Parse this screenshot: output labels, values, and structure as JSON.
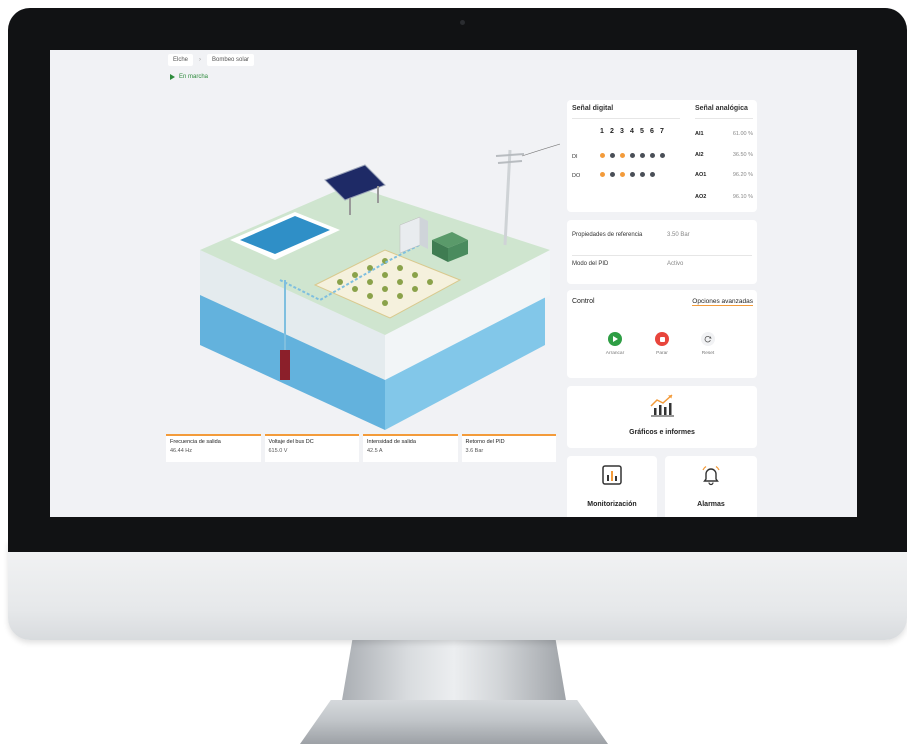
{
  "breadcrumb": {
    "location": "Elche",
    "separator": "›",
    "page": "Bombeo solar"
  },
  "status": {
    "label": "En marcha",
    "color": "#2e8b3c"
  },
  "metrics": [
    {
      "label": "Frecuencia de salida",
      "value": "46.44 Hz"
    },
    {
      "label": "Voltaje del bus DC",
      "value": "615.0 V"
    },
    {
      "label": "Intensidad de salida",
      "value": "42.5 A"
    },
    {
      "label": "Retorno del PID",
      "value": "3.6 Bar"
    }
  ],
  "signals": {
    "digital_title": "Señal digital",
    "analog_title": "Señal analógica",
    "columns": [
      "1",
      "2",
      "3",
      "4",
      "5",
      "6",
      "7"
    ],
    "rows": [
      {
        "label": "DI",
        "dots": [
          "orange",
          "gray",
          "orange",
          "gray",
          "gray",
          "gray",
          "gray"
        ]
      },
      {
        "label": "DO",
        "dots": [
          "orange",
          "gray",
          "orange",
          "gray",
          "gray",
          "gray"
        ]
      }
    ],
    "analog": [
      {
        "name": "AI1",
        "value": "61.00 %"
      },
      {
        "name": "AI2",
        "value": "36.50 %"
      },
      {
        "name": "AO1",
        "value": "96.20 %"
      },
      {
        "name": "AO2",
        "value": "96.10 %"
      }
    ],
    "colors": {
      "orange": "#f39b3a",
      "gray": "#4a4f57"
    }
  },
  "props": {
    "ref_label": "Propiedades de referencia",
    "ref_value": "3.50 Bar",
    "pid_label": "Modo del PID",
    "pid_value": "Activo"
  },
  "control": {
    "title": "Control",
    "advanced_link": "Opciones avanzadas",
    "start_label": "Arrancar",
    "stop_label": "Parar",
    "reset_label": "Reset",
    "start_color": "#2e9e44",
    "stop_color": "#e8453c"
  },
  "reports": {
    "title": "Gráficos e informes"
  },
  "monitoring": {
    "title": "Monitorización"
  },
  "alarms": {
    "title": "Alarmas"
  },
  "accent_color": "#f39b3a"
}
